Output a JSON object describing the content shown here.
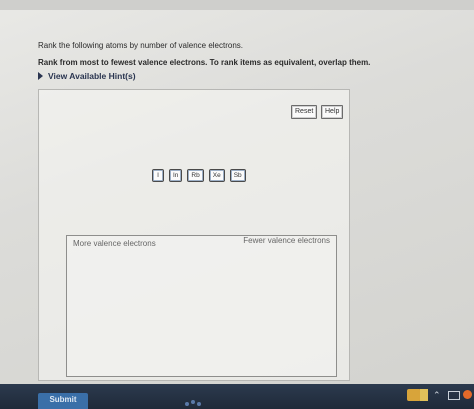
{
  "question": {
    "prompt": "Rank the following atoms by number of valence electrons.",
    "instruction": "Rank from most to fewest valence electrons. To rank items as equivalent, overlap them.",
    "hint_label": "View Available Hint(s)"
  },
  "toolbar": {
    "reset_label": "Reset",
    "help_label": "Help"
  },
  "items": [
    "I",
    "In",
    "Rb",
    "Xe",
    "Sb"
  ],
  "ranking": {
    "left_label": "More valence electrons",
    "right_label": "Fewer valence electrons"
  },
  "submit_label": "Submit",
  "colors": {
    "accent": "#3a6fa8",
    "hint_text": "#2a3550",
    "tile_glow": "#9db0c7"
  }
}
